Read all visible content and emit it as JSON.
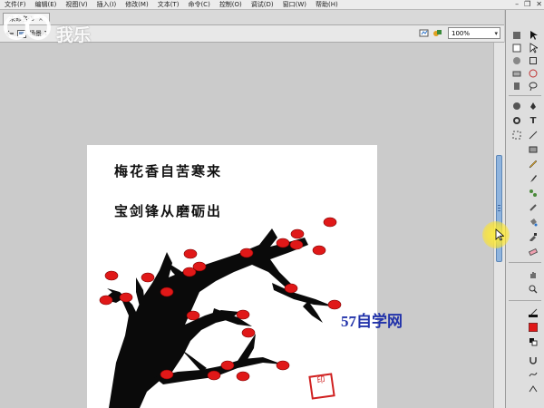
{
  "menu": {
    "items": [
      "文件(F)",
      "编辑(E)",
      "视图(V)",
      "插入(I)",
      "修改(M)",
      "文本(T)",
      "命令(C)",
      "控制(O)",
      "调试(D)",
      "窗口(W)",
      "帮助(H)"
    ]
  },
  "window_controls": {
    "minimize": "–",
    "restore": "❐",
    "close": "✕"
  },
  "tab": {
    "label": "未命名-5",
    "close": "×"
  },
  "editbar": {
    "scene_label": "场景 1",
    "zoom_value": "100%"
  },
  "logo": {
    "text": "我乐"
  },
  "stage": {
    "poem_line_1": "梅花香自苦寒来",
    "poem_line_2": "宝剑锋从磨砺出",
    "site_label": "57自学网",
    "seal_text": "印"
  },
  "colors": {
    "accent": "#8fb4de",
    "blossom": "#e01818",
    "branch": "#0a0a0a",
    "site_label": "#2233aa"
  },
  "icons": {
    "tools": [
      "selection-icon",
      "subselection-icon",
      "free-transform-icon",
      "gradient-icon",
      "lasso-icon",
      "3d-rotation-icon",
      "pen-icon",
      "text-icon",
      "line-icon",
      "rectangle-icon",
      "pencil-icon",
      "brush-icon",
      "deco-icon",
      "bone-icon",
      "paint-bucket-icon",
      "eyedropper-icon",
      "eraser-icon",
      "hand-icon",
      "zoom-icon",
      "stroke-color-icon",
      "fill-color-icon"
    ]
  }
}
